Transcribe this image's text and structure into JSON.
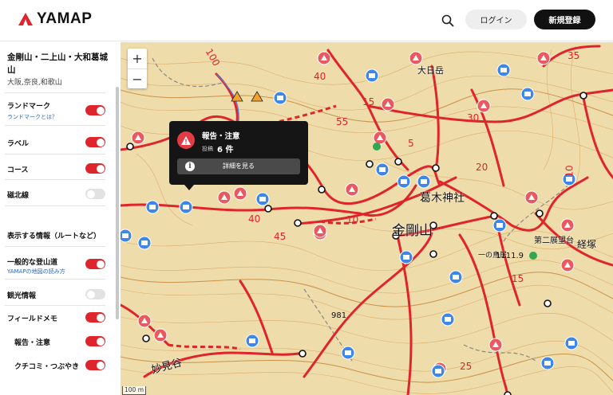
{
  "header": {
    "brand": "YAMAP",
    "login_label": "ログイン",
    "register_label": "新規登録",
    "icons": {
      "logo": "mountain-logo-icon",
      "search": "search-icon"
    },
    "colors": {
      "brand": "#e0242c",
      "register_bg": "#111111"
    }
  },
  "sidebar": {
    "area_title": "金剛山・二上山・大和葛城山",
    "prefectures": "大阪,奈良,和歌山",
    "layers": [
      {
        "label": "ランドマーク",
        "on": true,
        "sub": "ランドマークとは？"
      },
      {
        "label": "ラベル",
        "on": true
      },
      {
        "label": "コース",
        "on": true
      },
      {
        "label": "磁北線",
        "on": false
      }
    ],
    "section_title": "表示する情報（ルートなど）",
    "info": [
      {
        "label": "一般的な登山道",
        "on": true,
        "sub": "YAMAPの地図の読み方"
      },
      {
        "label": "観光情報",
        "on": false
      },
      {
        "label": "フィールドメモ",
        "on": true
      },
      {
        "label": "報告・注意",
        "on": true
      },
      {
        "label": "クチコミ・つぶやき",
        "on": true
      }
    ]
  },
  "map": {
    "zoom_in": "+",
    "zoom_out": "−",
    "scale": "100 m",
    "popup": {
      "title": "報告・注意",
      "count_label": "投稿",
      "count": "6 件",
      "button": "詳細を見る",
      "icons": [
        "warning-icon",
        "info-icon"
      ]
    },
    "place_labels": [
      "金剛山",
      "葛木神社",
      "大日岳",
      "第二展望台",
      "一の鳥居",
      "妙見谷",
      "経塚"
    ],
    "route_numbers": [
      "100",
      "40",
      "15",
      "55",
      "20",
      "10",
      "5",
      "25",
      "45",
      "35",
      "30"
    ],
    "elevations": [
      "1111.9",
      "981"
    ],
    "colors": {
      "route": "#e0242c",
      "terrain": "#efdcab",
      "contour": "#d9a55e",
      "water": "#4a83e0"
    }
  }
}
